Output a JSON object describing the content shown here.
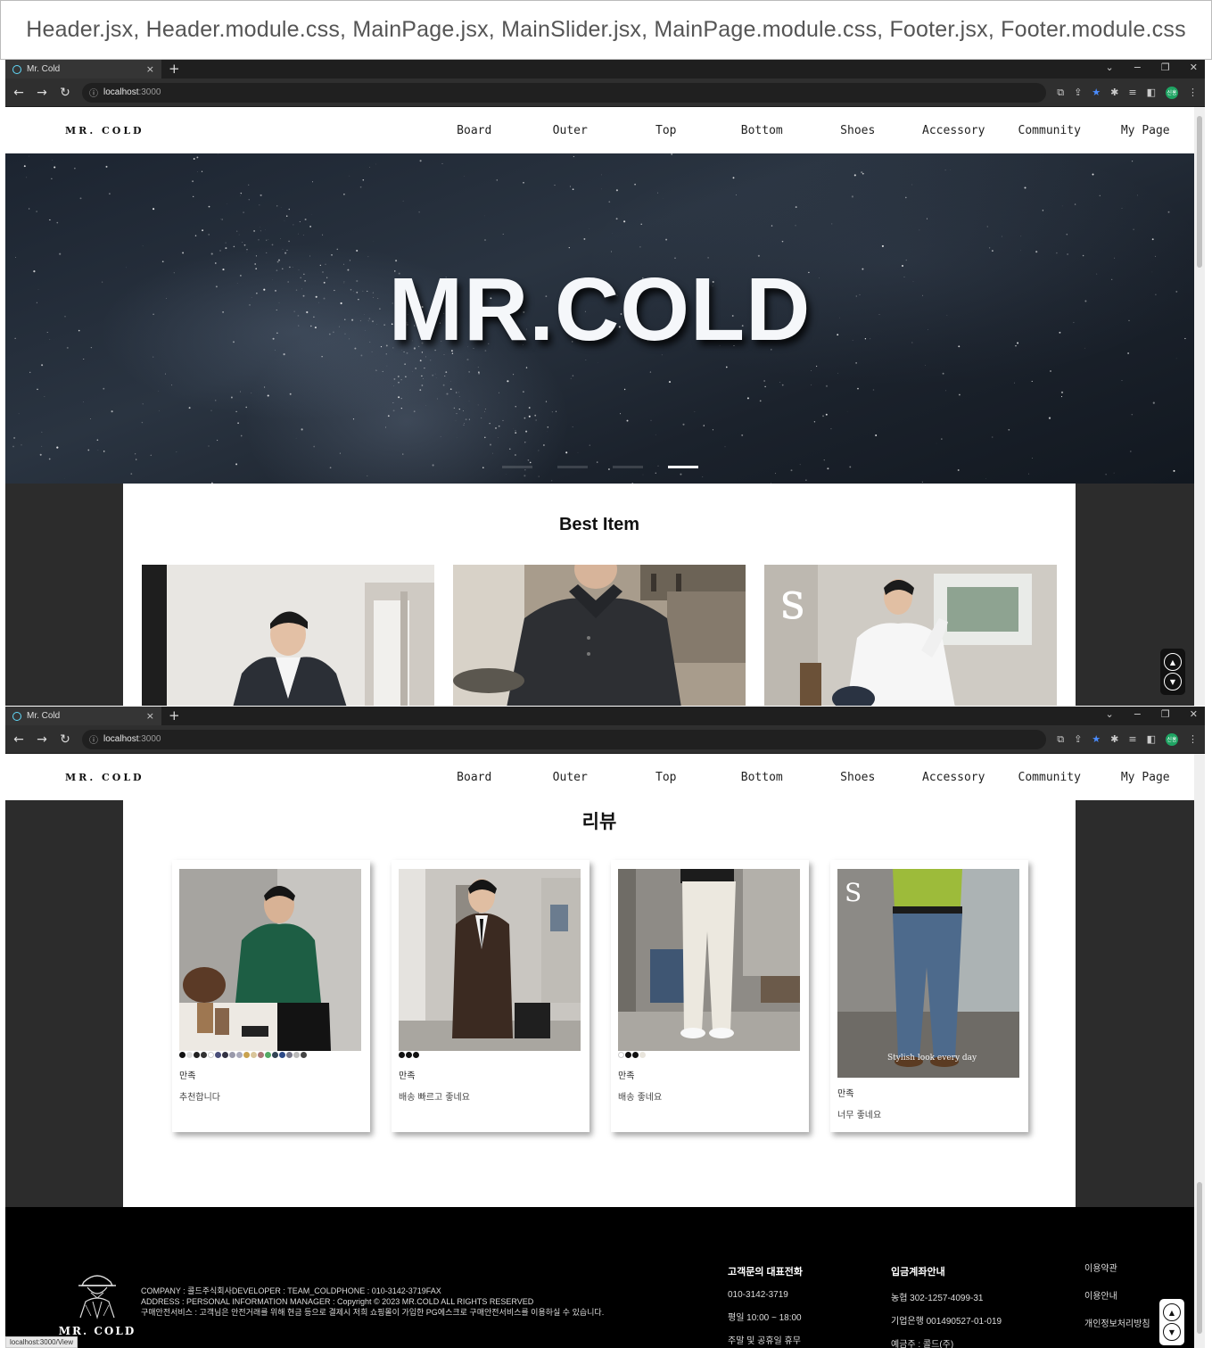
{
  "caption": "Header.jsx,  Header.module.css,  MainPage.jsx,  MainSlider.jsx,  MainPage.module.css,  Footer.jsx,  Footer.module.css",
  "browser": {
    "tab_title": "Mr. Cold",
    "tab_close": "×",
    "new_tab": "+",
    "url_host": "localhost",
    "url_port": ":3000",
    "window_controls": [
      "⌄",
      "−",
      "❐",
      "✕"
    ],
    "profile_label": "신홍"
  },
  "header": {
    "logo": "MR. COLD",
    "nav": [
      "Board",
      "Outer",
      "Top",
      "Bottom",
      "Shoes",
      "Accessory",
      "Community",
      "My Page"
    ]
  },
  "hero": {
    "title": "MR.COLD",
    "slide_count": 4,
    "active_slide": 4
  },
  "best": {
    "title": "Best Item"
  },
  "reviews": {
    "title": "리뷰",
    "items": [
      {
        "rating": "만족",
        "comment": "추천합니다"
      },
      {
        "rating": "만족",
        "comment": "배송 빠르고 좋네요"
      },
      {
        "rating": "만족",
        "comment": "배송 좋네요"
      },
      {
        "rating": "만족",
        "comment": "너무 좋네요"
      }
    ],
    "photo_caption": "Stylish look every day"
  },
  "footer": {
    "logo": "MR. COLD",
    "info_lines": [
      "COMPANY : 콜드주식회사DEVELOPER : TEAM_COLDPHONE : 010-3142-3719FAX",
      "ADDRESS : PERSONAL INFORMATION MANAGER : Copyright © 2023 MR.COLD ALL RIGHTS RESERVED",
      "구매안전서비스 : 고객님은 안전거래를 위해 현금 등으로 결제시 저희 쇼핑몰이 가입한 PG에스크로 구매안전서비스를 이용하실 수 있습니다."
    ],
    "cs_title": "고객문의 대표전화",
    "cs_lines": [
      "010-3142-3719",
      "평일 10:00 ~ 18:00",
      "주말 및 공휴일 휴무"
    ],
    "bank_title": "입금계좌안내",
    "bank_lines": [
      "농협 302-1257-4099-31",
      "기업은행 001490527-01-019",
      "예금주 : 콜드(주)"
    ],
    "links": [
      "이용약관",
      "이용안내",
      "개인정보처리방침"
    ]
  },
  "status_url": "localhost:3000/View",
  "colors": {
    "header_bg": "#ffffff",
    "page_bg": "#2c2c2c",
    "footer_bg": "#000000",
    "browser_chrome": "#1f1f1f",
    "accent_blue": "#4a8cff"
  }
}
